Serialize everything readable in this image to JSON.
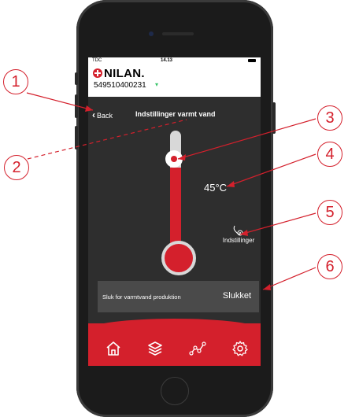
{
  "status_bar": {
    "carrier": "TDC",
    "time": "14.13"
  },
  "brand": {
    "logo": "NILAN.",
    "serial": "549510400231"
  },
  "nav": {
    "back_label": "Back",
    "title": "Indstillinger varmt vand"
  },
  "temperature": {
    "value": "45°C"
  },
  "settings": {
    "label": "Indstillinger",
    "icon": "settings-icon"
  },
  "production": {
    "label": "Sluk for varmtvand produktion",
    "value": "Slukket"
  },
  "tabs": [
    {
      "name": "home",
      "icon": "home-icon"
    },
    {
      "name": "layers",
      "icon": "layers-icon"
    },
    {
      "name": "graph",
      "icon": "graph-icon"
    },
    {
      "name": "settings",
      "icon": "gear-icon"
    }
  ],
  "callouts": [
    "1",
    "2",
    "3",
    "4",
    "5",
    "6"
  ],
  "colors": {
    "accent": "#d4202c",
    "background": "#2e2e2e",
    "row": "#4a4a4a"
  }
}
